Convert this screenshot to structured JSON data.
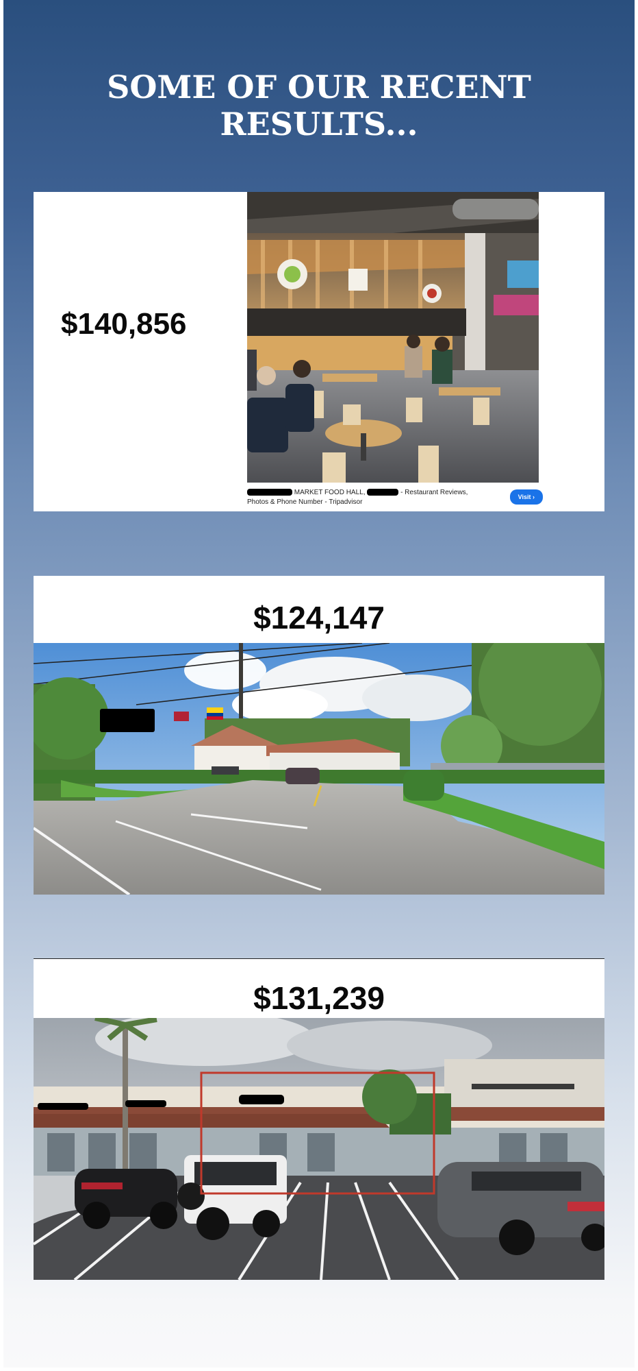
{
  "header": {
    "title": "SOME OF OUR RECENT RESULTS..."
  },
  "results": [
    {
      "amount": "$140,856",
      "image": "food-hall-interior",
      "caption": {
        "line1_a": "MARKET FOOD HALL,",
        "line1_b": "- Restaurant Reviews,",
        "line2": "Photos & Phone Number - Tripadvisor",
        "visit_label": "Visit ›"
      }
    },
    {
      "amount": "$124,147",
      "image": "street-view-restaurant-entrance"
    },
    {
      "amount": "$131,239",
      "image": "street-view-shopping-plaza"
    }
  ],
  "colors": {
    "background_top": "#2a4f7e",
    "background_bottom": "#f9f9fa",
    "visit_button": "#1a73e8",
    "highlight_box": "#c0392b"
  }
}
